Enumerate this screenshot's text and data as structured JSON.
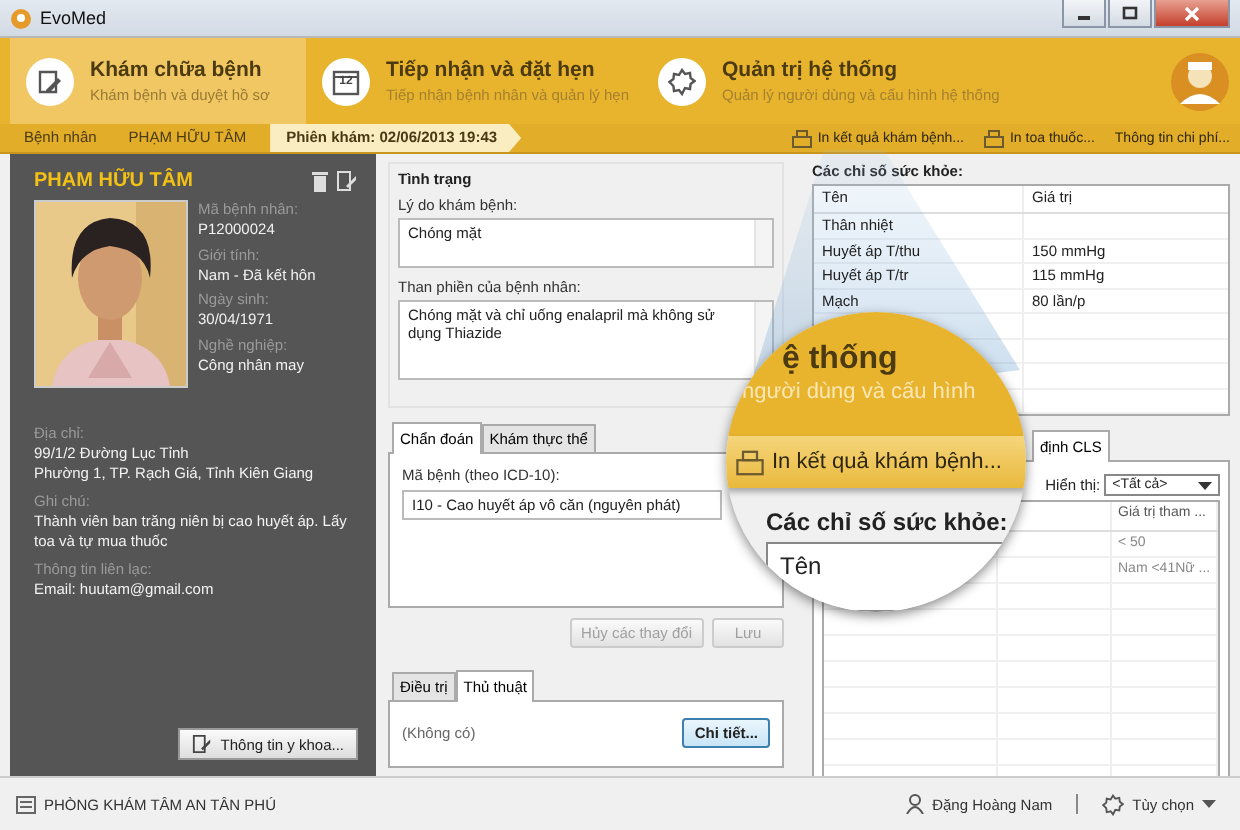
{
  "window": {
    "title": "EvoMed"
  },
  "modules": [
    {
      "title": "Khám chữa bệnh",
      "subtitle": "Khám bệnh và duyệt hồ sơ",
      "selected": true,
      "kind": "notepad"
    },
    {
      "title": "Tiếp nhận và đặt hẹn",
      "subtitle": "Tiếp nhận bệnh nhân và quản lý hẹn",
      "selected": false,
      "kind": "calendar"
    },
    {
      "title": "Quản trị hệ thống",
      "subtitle": "Quản lý người dùng và cấu hình hệ thống",
      "selected": false,
      "kind": "gear"
    }
  ],
  "calendar_day": "12",
  "breadcrumb": [
    {
      "label": "Bệnh nhân",
      "selected": false
    },
    {
      "label": "PHẠM HỮU TÂM",
      "selected": false
    },
    {
      "label": "Phiên khám: 02/06/2013 19:43",
      "selected": true
    }
  ],
  "actions": [
    {
      "label": "In kết quả khám bệnh...",
      "kind": "print"
    },
    {
      "label": "In toa thuốc...",
      "kind": "print"
    },
    {
      "label": "Thông tin chi phí...",
      "kind": "text"
    }
  ],
  "patient": {
    "name": "PHẠM HỮU TÂM",
    "fields": [
      {
        "label": "Mã bệnh nhân:",
        "value": "P12000024"
      },
      {
        "label": "Giới tính:",
        "value": "Nam - Đã kết hôn"
      },
      {
        "label": "Ngày sinh:",
        "value": "30/04/1971"
      },
      {
        "label": "Nghề nghiệp:",
        "value": "Công nhân may"
      }
    ],
    "details": [
      {
        "label": "Địa chỉ:",
        "lines": [
          "99/1/2 Đường Lục Tỉnh",
          "Phường 1, TP. Rạch Giá, Tỉnh Kiên Giang"
        ]
      },
      {
        "label": "Ghi chú:",
        "lines": [
          "Thành viên ban trăng niên bị cao huyết áp. Lấy toa và tự mua thuốc"
        ]
      },
      {
        "label": "Thông tin liên lạc:",
        "lines": [
          "Email: huutam@gmail.com"
        ]
      }
    ],
    "button": "Thông tin y khoa..."
  },
  "status": {
    "title": "Tình trạng",
    "reason_label": "Lý do khám bệnh:",
    "reason": "Chóng mặt",
    "complaint_label": "Than phiền của bệnh nhân:",
    "complaint": "Chóng mặt và chỉ uống enalapril mà không sử dụng Thiazide"
  },
  "diagnosis": {
    "tabs": [
      {
        "label": "Chẩn đoán",
        "selected": true
      },
      {
        "label": "Khám thực thể",
        "selected": false
      }
    ],
    "code_label": "Mã bệnh (theo ICD-10):",
    "code": "I10 - Cao huyết áp vô căn (nguyên phát)",
    "buttons": [
      {
        "label": "Hủy các thay đổi",
        "disabled": true
      },
      {
        "label": "Lưu",
        "disabled": true
      }
    ]
  },
  "treatment": {
    "tabs": [
      {
        "label": "Điều trị",
        "selected": false
      },
      {
        "label": "Thủ thuật",
        "selected": true
      }
    ],
    "empty_text": "(Không có)",
    "button": "Chi tiết..."
  },
  "vitals": {
    "title": "Các chỉ số sức khỏe:",
    "columns": [
      "Tên",
      "Giá trị"
    ],
    "rows": [
      {
        "name": "Thân nhiệt"
      },
      {
        "name": "Huyết áp T/thu",
        "value": "150 mmHg"
      },
      {
        "name": "Huyết áp T/tr",
        "value": "115 mmHg"
      },
      {
        "name": "Mạch",
        "value": "80 lần/p"
      }
    ]
  },
  "lab": {
    "tabs": [
      {
        "label": "định CLS",
        "selected": true
      }
    ],
    "show_label": "Hiển thị:",
    "filter": "<Tất cả>",
    "column_3": "Giá trị tham ...",
    "rows": [
      {
        "reference": "< 50"
      },
      {
        "reference": "Nam <41Nữ ..."
      }
    ]
  },
  "magnifier": {
    "heading": "ệ thống",
    "subheading": "người dùng và cấu hình",
    "action": "In kết quả khám bệnh...",
    "section": "Các chỉ số sức khỏe:",
    "column": "Tên"
  },
  "status_bar": {
    "clinic": "PHÒNG KHÁM TÂM AN TÂN PHÚ",
    "user": "Đặng Hoàng Nam",
    "options": "Tùy chọn"
  }
}
